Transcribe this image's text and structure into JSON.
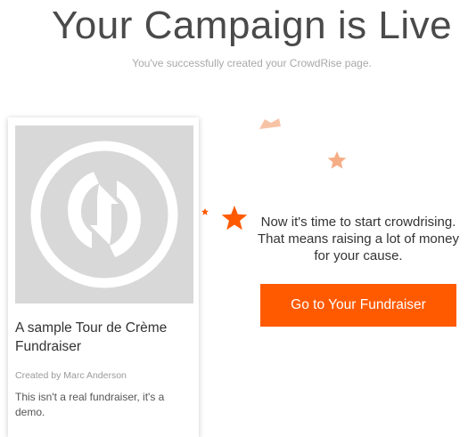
{
  "header": {
    "title": "Your Campaign is Live",
    "subtitle": "You've successfully created your CrowdRise page."
  },
  "card": {
    "image_icon": "crowdrise-logo-placeholder",
    "title": "A sample Tour de Crème Fundraiser",
    "creator": "Created by Marc Anderson",
    "description": "This isn't a real fundraiser, it's a demo."
  },
  "main": {
    "message": "Now it's time to start crowdrising. That means raising a lot of money for your cause.",
    "cta_label": "Go to Your Fundraiser"
  },
  "colors": {
    "accent": "#ff5a00",
    "star_light": "#f7b48f",
    "placeholder_bg": "#d8d8d8"
  }
}
